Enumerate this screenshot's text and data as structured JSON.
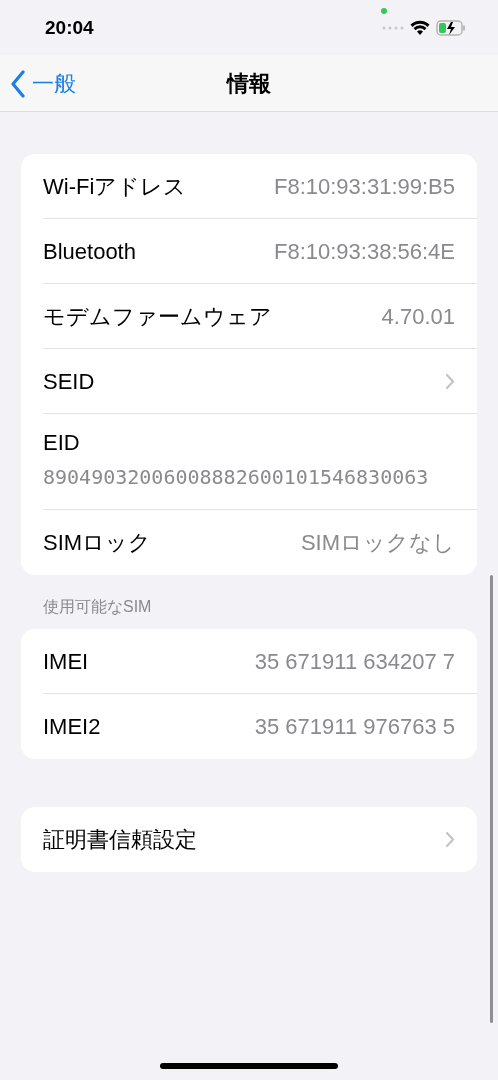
{
  "status_bar": {
    "time": "20:04"
  },
  "nav": {
    "back": "一般",
    "title": "情報"
  },
  "groups": [
    {
      "rows": [
        {
          "kind": "value",
          "label": "Wi-Fiアドレス",
          "value": "F8:10:93:31:99:B5"
        },
        {
          "kind": "value",
          "label": "Bluetooth",
          "value": "F8:10:93:38:56:4E"
        },
        {
          "kind": "value",
          "label": "モデムファームウェア",
          "value": "4.70.01"
        },
        {
          "kind": "chevron",
          "label": "SEID"
        },
        {
          "kind": "block",
          "label": "EID",
          "value": "89049032006008882600101546830063"
        },
        {
          "kind": "value",
          "label": "SIMロック",
          "value": "SIMロックなし"
        }
      ]
    },
    {
      "header": "使用可能なSIM",
      "rows": [
        {
          "kind": "value",
          "label": "IMEI",
          "value": "35 671911 634207 7"
        },
        {
          "kind": "value",
          "label": "IMEI2",
          "value": "35 671911 976763 5"
        }
      ]
    },
    {
      "rows": [
        {
          "kind": "chevron",
          "label": "証明書信頼設定"
        }
      ]
    }
  ]
}
